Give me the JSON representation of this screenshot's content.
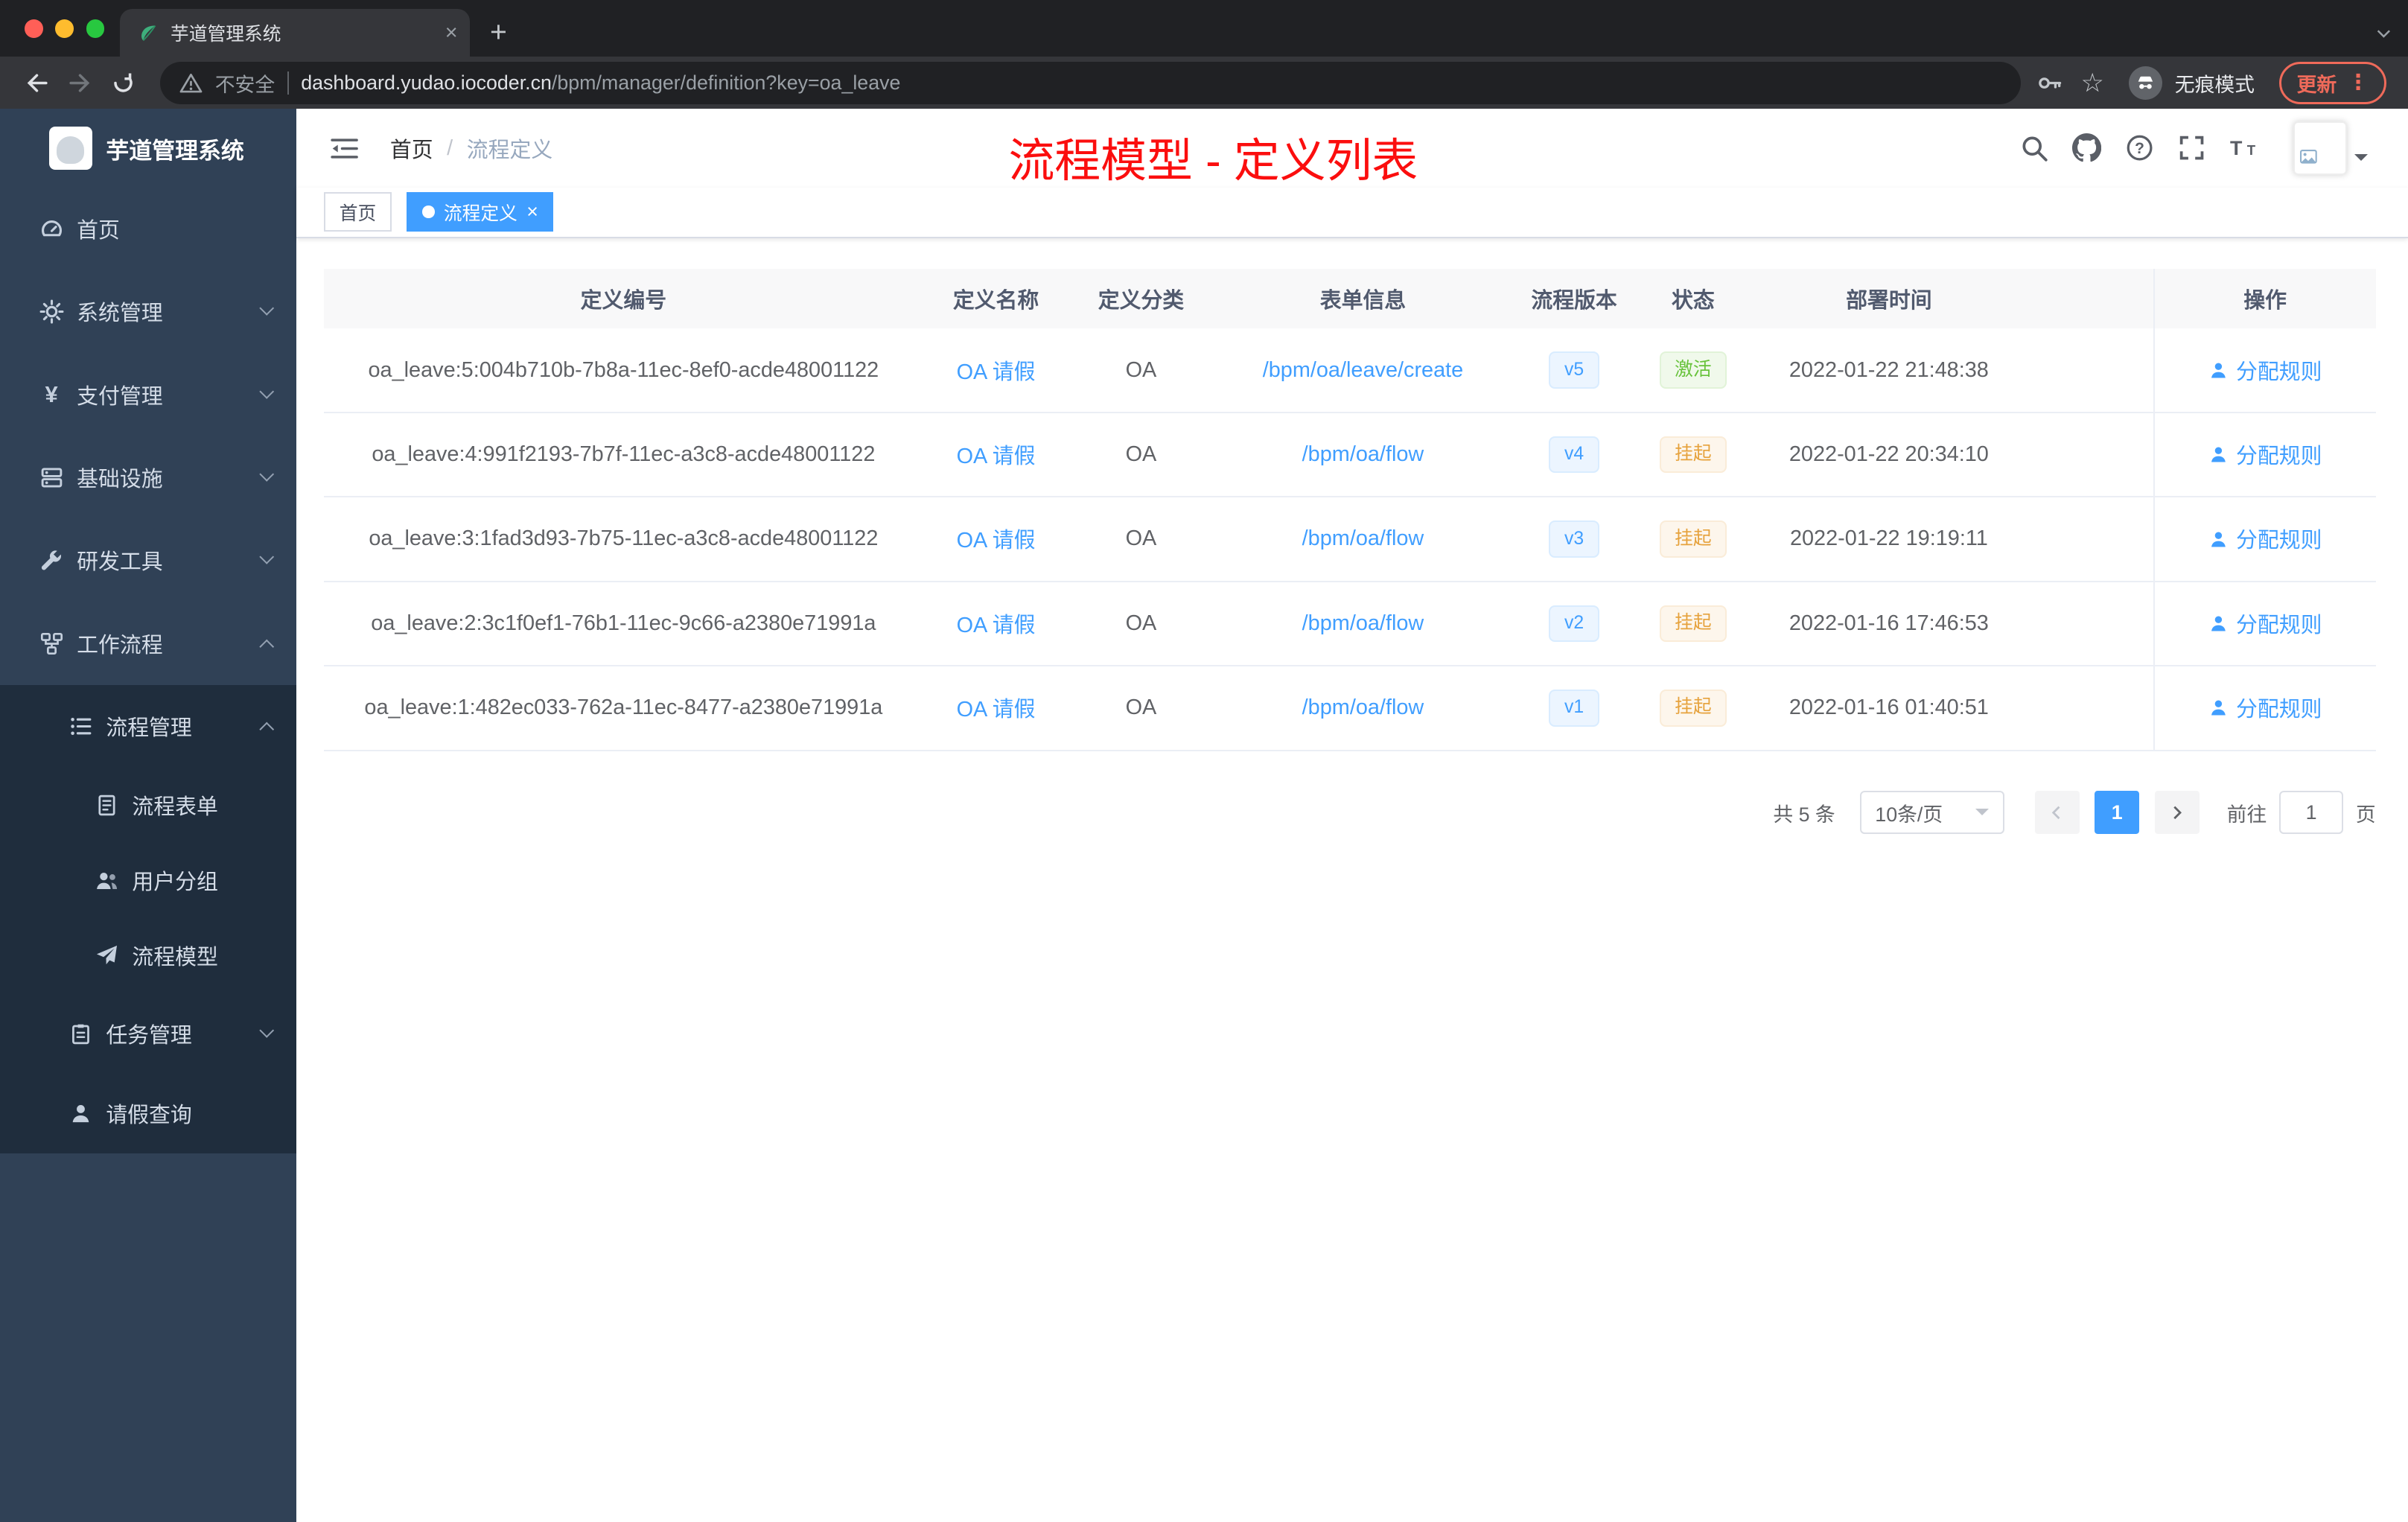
{
  "browser": {
    "tab_title": "芋道管理系统",
    "security_label": "不安全",
    "url_host": "dashboard.yudao.iocoder.cn",
    "url_path": "/bpm/manager/definition?key=oa_leave",
    "incognito_label": "无痕模式",
    "update_label": "更新"
  },
  "sidebar": {
    "logo_title": "芋道管理系统",
    "items": [
      {
        "label": "首页",
        "icon": "dashboard-icon"
      },
      {
        "label": "系统管理",
        "icon": "gear-icon",
        "expandable": true
      },
      {
        "label": "支付管理",
        "icon": "yen-icon",
        "expandable": true
      },
      {
        "label": "基础设施",
        "icon": "infrastructure-icon",
        "expandable": true
      },
      {
        "label": "研发工具",
        "icon": "tools-icon",
        "expandable": true
      },
      {
        "label": "工作流程",
        "icon": "workflow-icon",
        "expandable": true,
        "expanded": true
      },
      {
        "label": "流程管理",
        "icon": "process-manage-icon",
        "expandable": true,
        "expanded": true,
        "level": 2
      },
      {
        "label": "流程表单",
        "icon": "form-icon",
        "level": 3
      },
      {
        "label": "用户分组",
        "icon": "user-group-icon",
        "level": 3
      },
      {
        "label": "流程模型",
        "icon": "model-icon",
        "level": 3
      },
      {
        "label": "任务管理",
        "icon": "task-icon",
        "expandable": true,
        "level": 2
      },
      {
        "label": "请假查询",
        "icon": "person-icon",
        "level": 2
      }
    ]
  },
  "header": {
    "breadcrumb_home": "首页",
    "breadcrumb_current": "流程定义",
    "annotation": "流程模型 - 定义列表",
    "icons": [
      "search-icon",
      "github-icon",
      "question-icon",
      "fullscreen-icon",
      "font-size-icon"
    ]
  },
  "tags": {
    "home": "首页",
    "current": "流程定义"
  },
  "table": {
    "columns": [
      "定义编号",
      "定义名称",
      "定义分类",
      "表单信息",
      "流程版本",
      "状态",
      "部署时间",
      "操作"
    ],
    "rows": [
      {
        "id": "oa_leave:5:004b710b-7b8a-11ec-8ef0-acde48001122",
        "name": "OA 请假",
        "category": "OA",
        "form": "/bpm/oa/leave/create",
        "version": "v5",
        "status": "激活",
        "status_type": "success",
        "time": "2022-01-22 21:48:38",
        "action": "分配规则"
      },
      {
        "id": "oa_leave:4:991f2193-7b7f-11ec-a3c8-acde48001122",
        "name": "OA 请假",
        "category": "OA",
        "form": "/bpm/oa/flow",
        "version": "v4",
        "status": "挂起",
        "status_type": "warning",
        "time": "2022-01-22 20:34:10",
        "action": "分配规则"
      },
      {
        "id": "oa_leave:3:1fad3d93-7b75-11ec-a3c8-acde48001122",
        "name": "OA 请假",
        "category": "OA",
        "form": "/bpm/oa/flow",
        "version": "v3",
        "status": "挂起",
        "status_type": "warning",
        "time": "2022-01-22 19:19:11",
        "action": "分配规则"
      },
      {
        "id": "oa_leave:2:3c1f0ef1-76b1-11ec-9c66-a2380e71991a",
        "name": "OA 请假",
        "category": "OA",
        "form": "/bpm/oa/flow",
        "version": "v2",
        "status": "挂起",
        "status_type": "warning",
        "time": "2022-01-16 17:46:53",
        "action": "分配规则"
      },
      {
        "id": "oa_leave:1:482ec033-762a-11ec-8477-a2380e71991a",
        "name": "OA 请假",
        "category": "OA",
        "form": "/bpm/oa/flow",
        "version": "v1",
        "status": "挂起",
        "status_type": "warning",
        "time": "2022-01-16 01:40:51",
        "action": "分配规则"
      }
    ]
  },
  "pagination": {
    "total": "共 5 条",
    "page_size": "10条/页",
    "current_page": "1",
    "goto_label": "前往",
    "goto_value": "1",
    "unit_label": "页"
  },
  "colors": {
    "accent": "#409eff",
    "success": "#67c23a",
    "warning": "#e6a23c",
    "sidebar_bg": "#304156",
    "submenu_bg": "#1f2d3d",
    "annotation_red": "#fb0e0e"
  }
}
